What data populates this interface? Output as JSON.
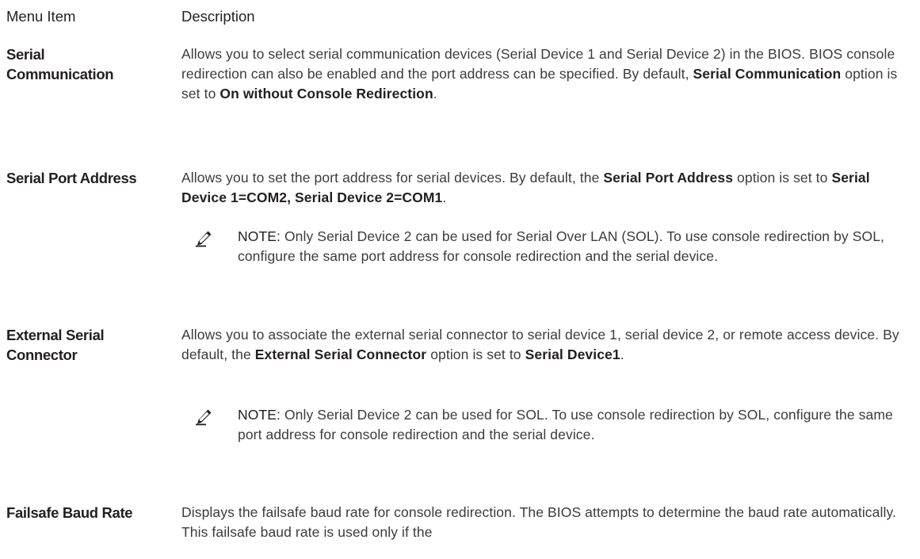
{
  "table": {
    "header": {
      "menu_item": "Menu Item",
      "description": "Description"
    },
    "rows": [
      {
        "term_lines": [
          "Serial",
          "Communication"
        ],
        "description": [
          {
            "text": "Allows you to select serial communication devices (Serial Device 1 and Serial Device 2) in the BIOS. BIOS console redirection can also be enabled and the port address can be specified. By default, ",
            "bold": false
          },
          {
            "text": "Serial Communication",
            "bold": true
          },
          {
            "text": " option is set to ",
            "bold": false
          },
          {
            "text": "On without Console Redirection",
            "bold": true
          },
          {
            "text": ".",
            "bold": false
          }
        ]
      },
      {
        "term_lines": [
          "Serial Port Address"
        ],
        "description": [
          {
            "text": "Allows you to set the port address for serial devices. By default, the ",
            "bold": false
          },
          {
            "text": "Serial Port Address",
            "bold": true
          },
          {
            "text": " option is set to ",
            "bold": false
          },
          {
            "text": "Serial Device 1=COM2, Serial Device 2=COM1",
            "bold": true
          },
          {
            "text": ".",
            "bold": false
          }
        ],
        "note": {
          "label": "NOTE:",
          "text": " Only Serial Device 2 can be used for Serial Over LAN (SOL). To use console redirection by SOL, configure the same port address for console redirection and the serial device."
        }
      },
      {
        "term_lines": [
          "External Serial",
          "Connector"
        ],
        "description": [
          {
            "text": "Allows you to associate the external serial connector to serial device 1, serial device 2, or remote access device. By default, the ",
            "bold": false
          },
          {
            "text": "External Serial Connector",
            "bold": true
          },
          {
            "text": " option is set to ",
            "bold": false
          },
          {
            "text": "Serial Device1",
            "bold": true
          },
          {
            "text": ".",
            "bold": false
          }
        ],
        "note": {
          "label": "NOTE:",
          "text": " Only Serial Device 2 can be used for SOL. To use console redirection by SOL, configure the same port address for console redirection and the serial device."
        }
      },
      {
        "term_lines": [
          "Failsafe Baud Rate"
        ],
        "description": [
          {
            "text": "Displays the failsafe baud rate for console redirection. The BIOS attempts to determine the baud rate automatically. This failsafe baud rate is used only if the",
            "bold": false
          }
        ]
      }
    ]
  },
  "icons": {
    "note_icon": "pencil-note-icon",
    "note_icon_color": "#231f20"
  },
  "colors": {
    "heading_text": "#231f20",
    "body_text": "#3b3b3b",
    "background": "#ffffff"
  }
}
